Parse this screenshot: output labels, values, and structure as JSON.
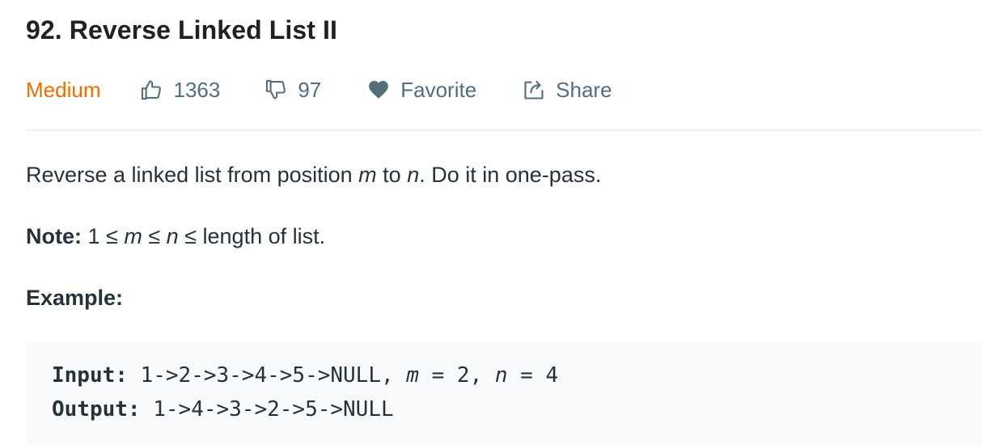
{
  "problem": {
    "title": "92. Reverse Linked List II",
    "difficulty": "Medium",
    "likes": "1363",
    "dislikes": "97",
    "favorite_label": "Favorite",
    "share_label": "Share"
  },
  "description": {
    "line1_prefix": "Reverse a linked list from position ",
    "line1_var_m": "m",
    "line1_mid": " to ",
    "line1_var_n": "n",
    "line1_suffix": ". Do it in one-pass.",
    "note_label": "Note:",
    "note_prefix": " 1 ≤ ",
    "note_var_m": "m",
    "note_mid": " ≤ ",
    "note_var_n": "n",
    "note_suffix": " ≤ length of list.",
    "example_heading": "Example:"
  },
  "example": {
    "input_label": "Input:",
    "input_list": " 1->2->3->4->5->NULL, ",
    "input_var_m": "m",
    "input_m_value": " = 2, ",
    "input_var_n": "n",
    "input_n_value": " = 4",
    "output_label": "Output:",
    "output_value": " 1->4->3->2->5->NULL"
  },
  "colors": {
    "difficulty_medium": "#ef6c00",
    "meta_text": "#546e7a",
    "body_text": "#263238",
    "code_background": "#f7f9fa",
    "divider": "#eceff1"
  },
  "icons": {
    "likes": "thumbs-up-icon",
    "dislikes": "thumbs-down-icon",
    "favorite": "heart-icon",
    "share": "share-icon"
  }
}
